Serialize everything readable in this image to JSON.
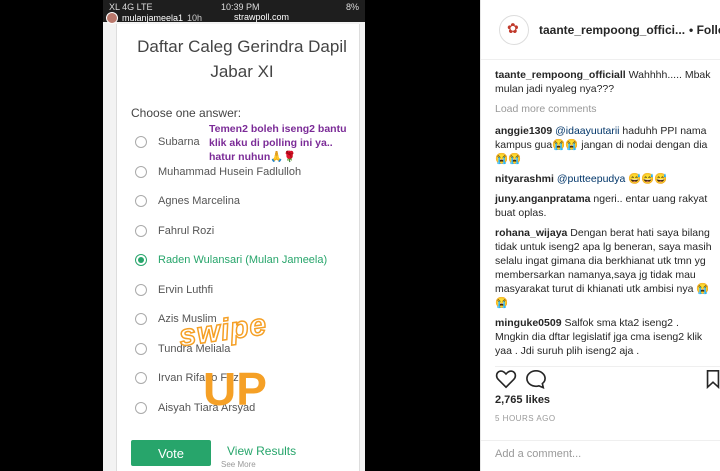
{
  "story": {
    "status": {
      "carrier": "XL 4G LTE",
      "time": "10:39 PM",
      "battery": "8%"
    },
    "user": "mulanjameela1",
    "age": "10h",
    "url": "strawpoll.com"
  },
  "poll": {
    "title": "Daftar Caleg Gerindra Dapil Jabar XI",
    "choose": "Choose one answer:",
    "options": [
      "Subarna",
      "Muhammad Husein Fadlulloh",
      "Agnes Marcelina",
      "Fahrul Rozi",
      "Raden Wulansari (Mulan Jameela)",
      "Ervin Luthfi",
      "Azis Muslim",
      "Tundra Meliala",
      "Irvan Rifano Fazri",
      "Aisyah Tiara Arsyad"
    ],
    "selected_index": 4,
    "vote_label": "Vote",
    "view_results": "View Results",
    "sticker": "Temen2 boleh iseng2 bantu klik aku di polling ini ya.. hatur nuhun🙏🌹",
    "swipe": "swipe",
    "up": "UP",
    "see_more": "See More"
  },
  "post": {
    "username": "taante_rempoong_offici...",
    "follow": "• Following",
    "caption_user": "taante_rempoong_officiall",
    "caption_text": "Wahhhh..... Mbak mulan jadi nyaleg nya???",
    "load_more": "Load more comments",
    "comments": [
      {
        "user": "anggie1309",
        "mention": "@idaayuutarii",
        "text": "haduhh PPI nama kampus gua😭😭 jangan di nodai dengan dia😭😭"
      },
      {
        "user": "nityarashmi",
        "mention": "@putteepudya",
        "text": "😅😅😅"
      },
      {
        "user": "juny.anganpratama",
        "mention": "",
        "text": "ngeri.. entar uang rakyat buat oplas."
      },
      {
        "user": "rohana_wijaya",
        "mention": "",
        "text": "Dengan berat hati saya bilang tidak untuk iseng2 apa lg beneran, saya masih selalu ingat gimana dia berkhianat utk tmn yg membersarkan namanya,saya jg tidak mau masyarakat turut di khianati utk ambisi nya 😭😭"
      },
      {
        "user": "minguke0509",
        "mention": "",
        "text": "Salfok sma kta2 iseng2 . Mngkin dia dftar legislatif jga cma iseng2 klik yaa . Jdi suruh plih iseng2 aja ."
      }
    ],
    "likes": "2,765 likes",
    "time": "5 HOURS AGO",
    "add_comment": "Add a comment..."
  }
}
